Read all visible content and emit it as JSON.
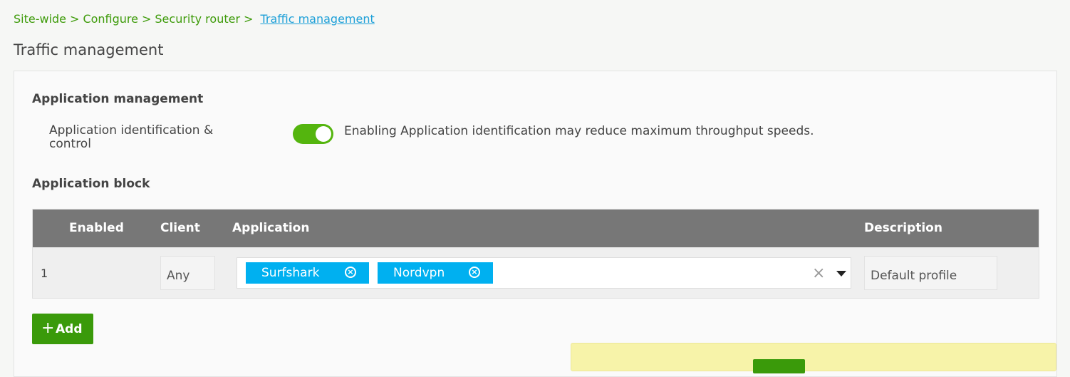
{
  "breadcrumb": {
    "items": [
      "Site-wide",
      "Configure",
      "Security router"
    ],
    "separator": ">",
    "current": "Traffic management"
  },
  "page": {
    "title": "Traffic management"
  },
  "app_management": {
    "title": "Application management",
    "label": "Application identification & control",
    "toggle_on": true,
    "note": "Enabling Application identification may reduce maximum throughput speeds."
  },
  "app_block": {
    "title": "Application block",
    "columns": {
      "enabled": "Enabled",
      "client": "Client",
      "application": "Application",
      "description": "Description"
    },
    "rows": [
      {
        "index": "1",
        "client": "Any",
        "applications": [
          "Surfshark",
          "Nordvpn"
        ],
        "description": "Default profile"
      }
    ],
    "add_label": "Add"
  },
  "colors": {
    "accent": "#3a9a0a",
    "link": "#1ea0d8",
    "chip": "#00b0f0",
    "header": "#777777",
    "notice": "#f7f3a9"
  }
}
